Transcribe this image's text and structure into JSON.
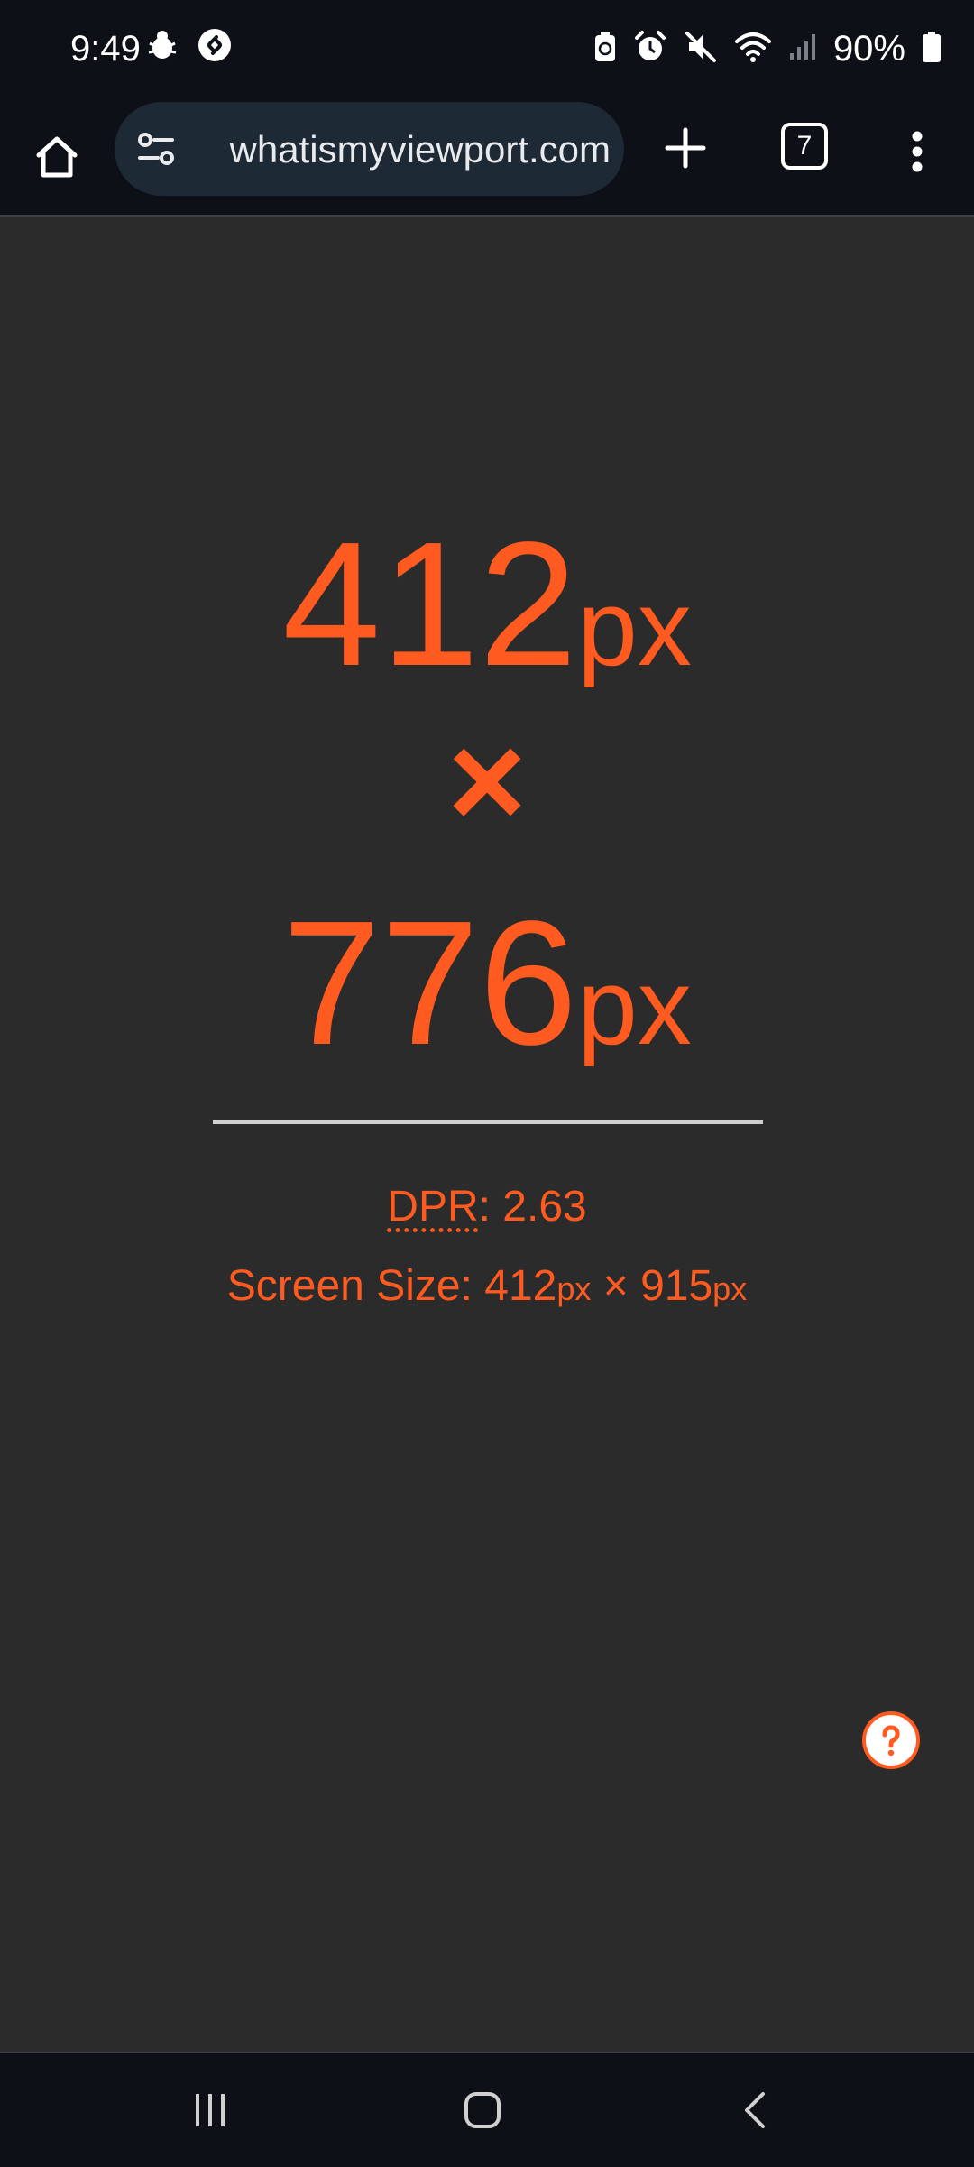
{
  "status_bar": {
    "time": "9:49",
    "left_icons": [
      "bug-notification-icon",
      "shazam-icon"
    ],
    "right_icons": [
      "battery-saver-icon",
      "alarm-icon",
      "mute-icon",
      "wifi-icon",
      "signal-icon"
    ],
    "battery_percent": "90%",
    "battery_level": 0.9
  },
  "toolbar": {
    "url": "whatismyviewport.com",
    "tab_count": "7",
    "icons": {
      "home": "home-icon",
      "site_settings": "tune-icon",
      "new_tab": "plus-icon",
      "menu": "more-vert-icon"
    }
  },
  "viewport": {
    "width_value": "412",
    "width_unit": "px",
    "times": "×",
    "height_value": "776",
    "height_unit": "px"
  },
  "info": {
    "dpr_label": "DPR",
    "dpr_sep": ": ",
    "dpr_value": "2.63",
    "screen_label": "Screen Size: ",
    "screen_width": "412",
    "screen_width_unit": "px",
    "screen_times": " × ",
    "screen_height": "915",
    "screen_height_unit": "px"
  },
  "help": {
    "icon": "question-mark-icon"
  },
  "nav_bar": {
    "icons": [
      "recents-icon",
      "home-icon",
      "back-icon"
    ]
  },
  "colors": {
    "accent": "#ff5a1f",
    "page_background": "#2b2b2b",
    "chrome_background": "#0d1117",
    "url_pill": "#1d2a35"
  }
}
